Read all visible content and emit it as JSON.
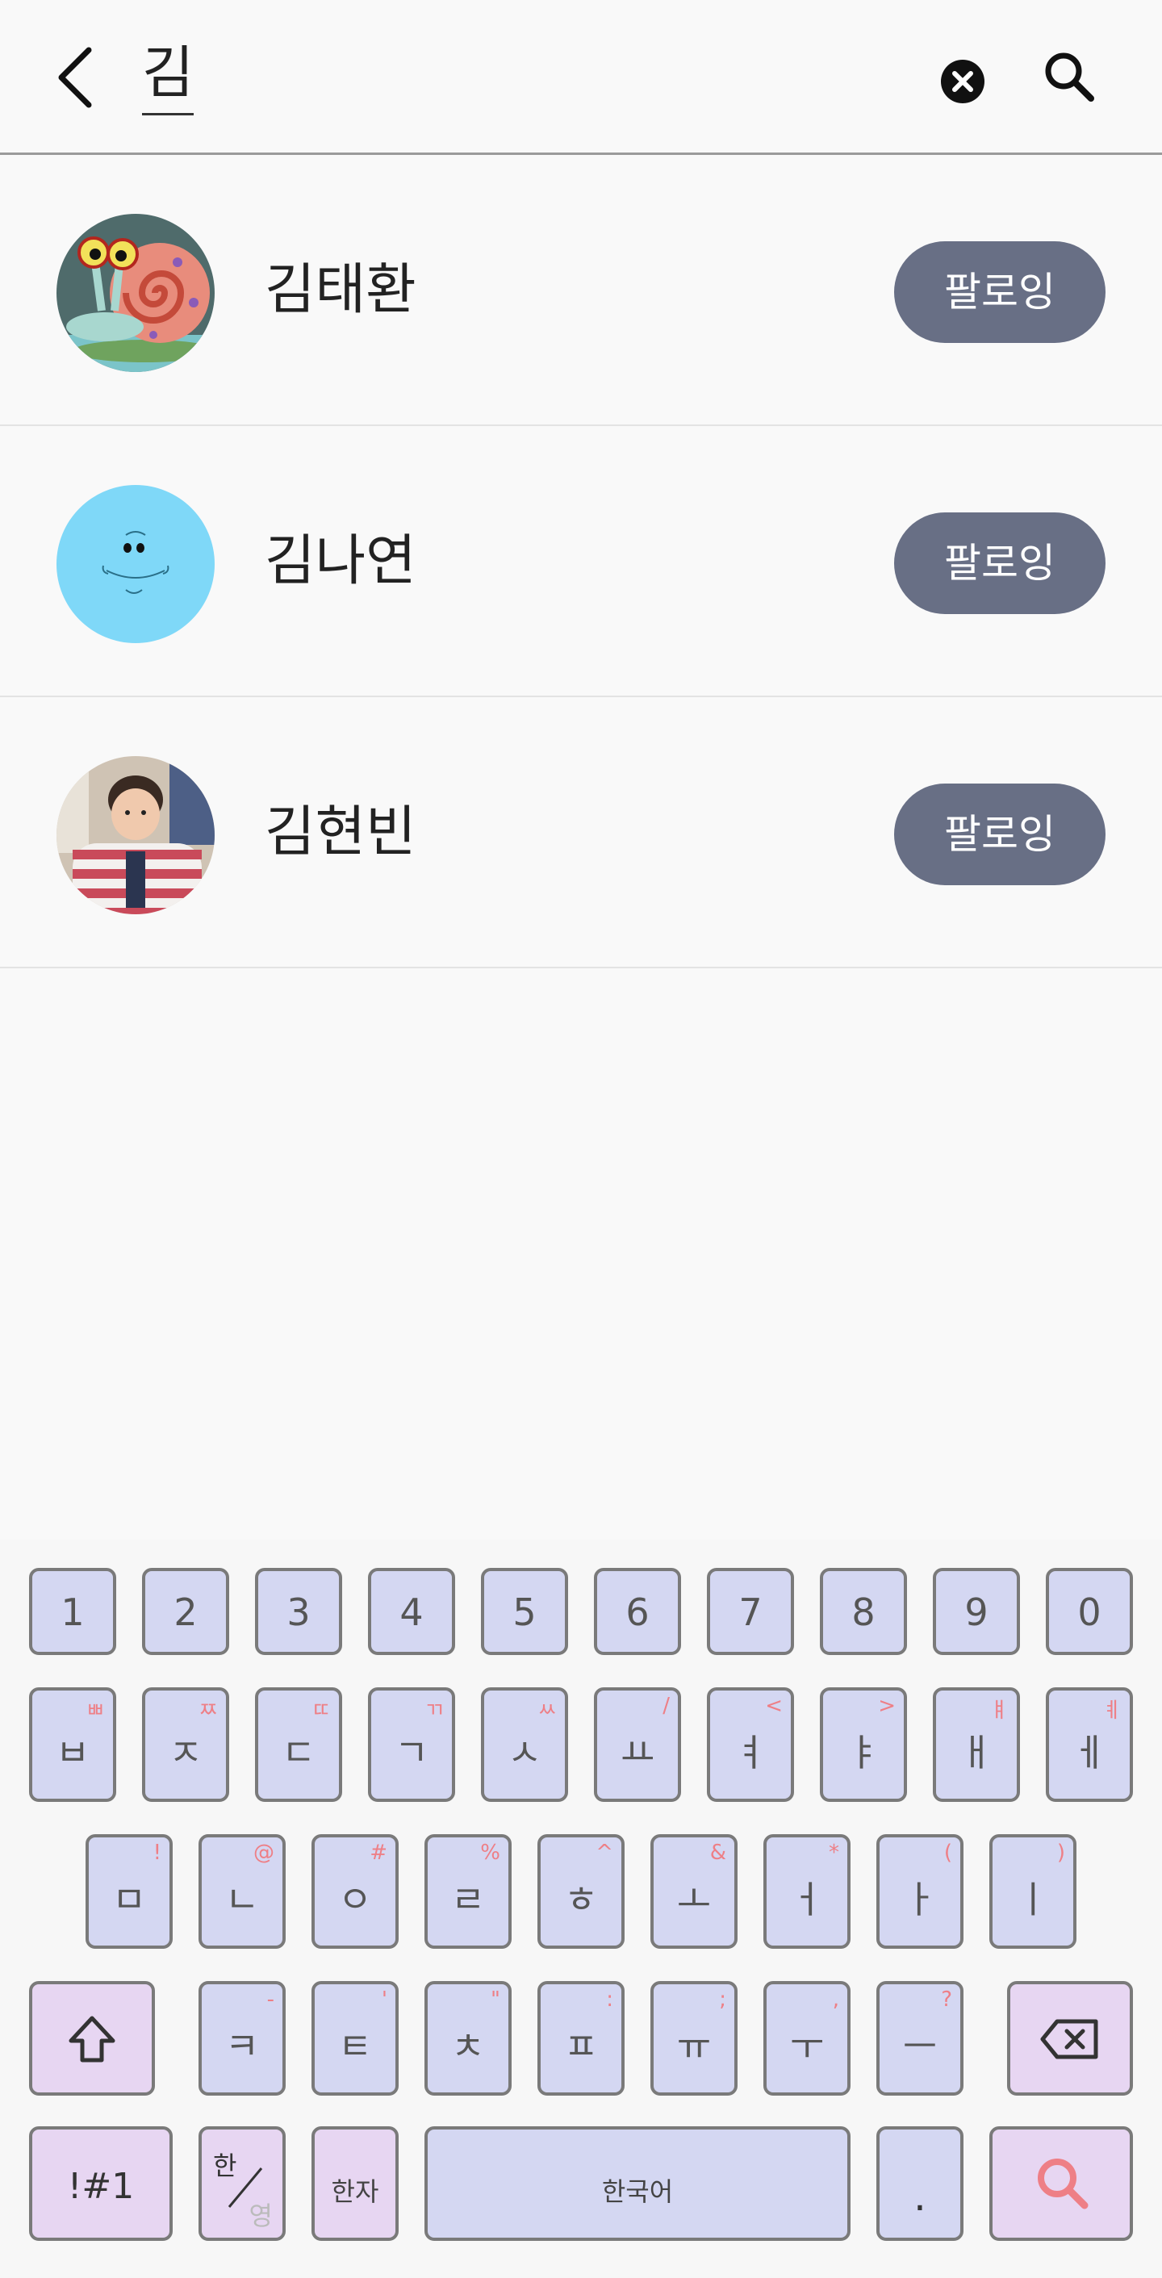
{
  "search": {
    "query": "김"
  },
  "results": [
    {
      "name": "김태환",
      "button": "팔로잉",
      "avatar": "snail-avatar"
    },
    {
      "name": "김나연",
      "button": "팔로잉",
      "avatar": "blue-face-avatar"
    },
    {
      "name": "김현빈",
      "button": "팔로잉",
      "avatar": "child-photo-avatar"
    }
  ],
  "keyboard": {
    "row_numbers": [
      "1",
      "2",
      "3",
      "4",
      "5",
      "6",
      "7",
      "8",
      "9",
      "0"
    ],
    "row1": [
      {
        "main": "ㅂ",
        "sub": "ㅃ"
      },
      {
        "main": "ㅈ",
        "sub": "ㅉ"
      },
      {
        "main": "ㄷ",
        "sub": "ㄸ"
      },
      {
        "main": "ㄱ",
        "sub": "ㄲ"
      },
      {
        "main": "ㅅ",
        "sub": "ㅆ"
      },
      {
        "main": "ㅛ",
        "sub": "/"
      },
      {
        "main": "ㅕ",
        "sub": "<"
      },
      {
        "main": "ㅑ",
        "sub": ">"
      },
      {
        "main": "ㅐ",
        "sub": "ㅒ"
      },
      {
        "main": "ㅔ",
        "sub": "ㅖ"
      }
    ],
    "row2": [
      {
        "main": "ㅁ",
        "sub": "!"
      },
      {
        "main": "ㄴ",
        "sub": "@"
      },
      {
        "main": "ㅇ",
        "sub": "#"
      },
      {
        "main": "ㄹ",
        "sub": "%"
      },
      {
        "main": "ㅎ",
        "sub": "^"
      },
      {
        "main": "ㅗ",
        "sub": "&"
      },
      {
        "main": "ㅓ",
        "sub": "*"
      },
      {
        "main": "ㅏ",
        "sub": "("
      },
      {
        "main": "ㅣ",
        "sub": ")"
      }
    ],
    "row3": [
      {
        "main": "ㅋ",
        "sub": "-"
      },
      {
        "main": "ㅌ",
        "sub": "'"
      },
      {
        "main": "ㅊ",
        "sub": "\""
      },
      {
        "main": "ㅍ",
        "sub": ":"
      },
      {
        "main": "ㅠ",
        "sub": ";"
      },
      {
        "main": "ㅜ",
        "sub": ","
      },
      {
        "main": "ㅡ",
        "sub": "?"
      }
    ],
    "symbols_label": "!#1",
    "lang_toggle_top": "한",
    "lang_toggle_bottom": "영",
    "hanja_label": "한자",
    "space_label": "한국어",
    "period_label": ".",
    "accent_color": "#ee7f86",
    "key_color": "#d4d7f2",
    "fn_key_color": "#e7d6f2"
  }
}
